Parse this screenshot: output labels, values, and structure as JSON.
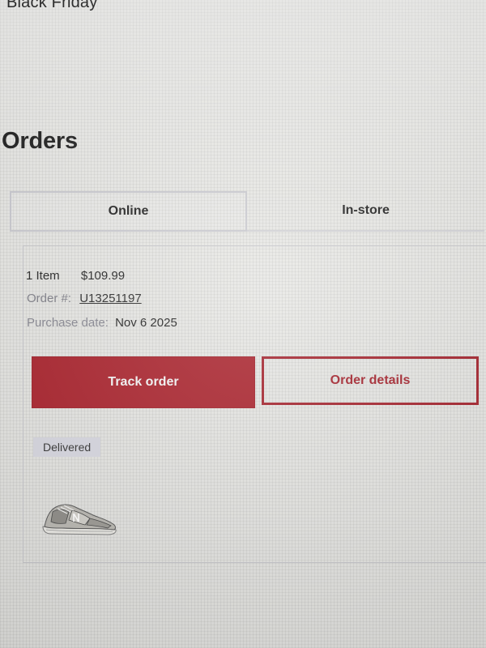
{
  "header": {
    "promo_link": "Black Friday"
  },
  "page": {
    "title": "Orders"
  },
  "tabs": [
    {
      "label": "Online",
      "active": true
    },
    {
      "label": "In-store",
      "active": false
    }
  ],
  "order": {
    "item_count": "1 Item",
    "total": "$109.99",
    "order_number_label": "Order #:",
    "order_number": "U13251197",
    "purchase_date_label": "Purchase date:",
    "purchase_date": "Nov 6 2025",
    "track_button_label": "Track order",
    "details_button_label": "Order details",
    "status": "Delivered",
    "product_image": "sneaker-image"
  },
  "colors": {
    "brand_red": "#a8202a",
    "badge_bg": "#d6d6df"
  }
}
